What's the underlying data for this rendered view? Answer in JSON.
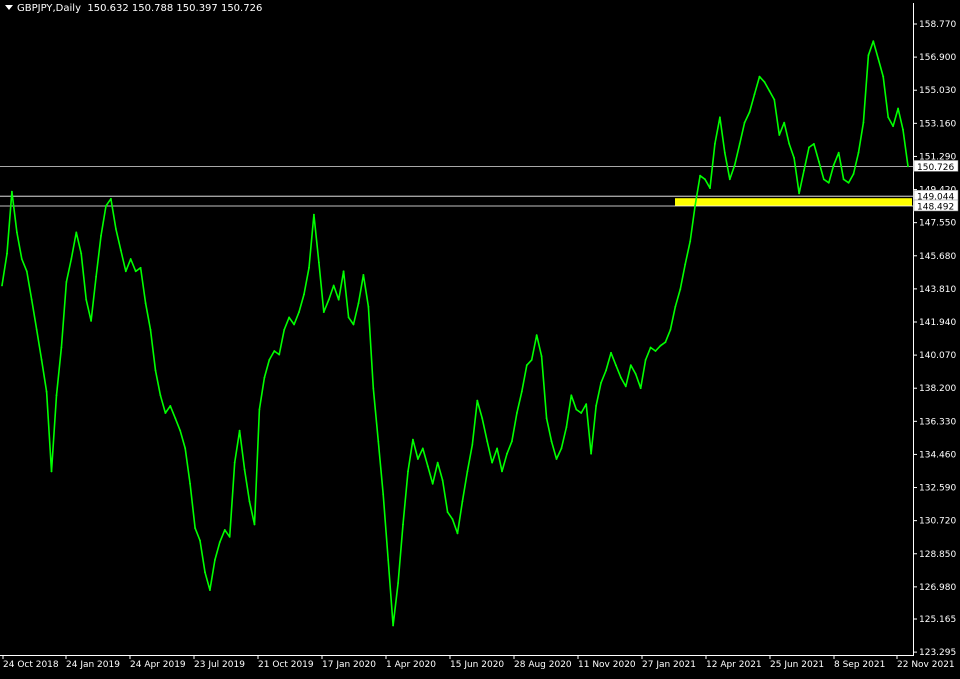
{
  "header": {
    "symbol": "GBPJPY,Daily",
    "ohlc": "150.632 150.788 150.397 150.726"
  },
  "colors": {
    "background": "#000000",
    "price_line": "#00ff00",
    "zone": "#ffff00",
    "axis": "#ffffff",
    "level_line": "#c0c0c0"
  },
  "chart_data": {
    "type": "line",
    "title": "",
    "xlabel": "",
    "ylabel": "",
    "ylim": [
      123.295,
      159.8
    ],
    "grid": false,
    "y_ticks": [
      "158.770",
      "156.900",
      "155.030",
      "153.160",
      "151.290",
      "149.420",
      "147.550",
      "145.680",
      "143.810",
      "141.940",
      "140.070",
      "138.200",
      "136.330",
      "134.460",
      "132.590",
      "130.720",
      "128.850",
      "126.980",
      "125.165",
      "123.295"
    ],
    "x_ticks": [
      "24 Oct 2018",
      "24 Jan 2019",
      "24 Apr 2019",
      "23 Jul 2019",
      "21 Oct 2019",
      "17 Jan 2020",
      "1 Apr 2020",
      "15 Jun 2020",
      "28 Aug 2020",
      "11 Nov 2020",
      "27 Jan 2021",
      "12 Apr 2021",
      "25 Jun 2021",
      "8 Sep 2021",
      "22 Nov 2021"
    ],
    "current_price": 150.726,
    "levels": [
      149.044,
      148.492
    ],
    "support_zone": [
      148.492,
      149.044
    ],
    "series": [
      {
        "values": [
          144.0,
          145.8,
          149.3,
          147.0,
          145.5,
          144.8,
          143.2,
          141.5,
          139.8,
          138.0,
          133.5,
          137.8,
          140.5,
          144.2,
          145.5,
          147.0,
          145.8,
          143.2,
          142.0,
          144.5,
          146.8,
          148.5,
          148.9,
          147.2,
          146.0,
          144.8,
          145.5,
          144.8,
          145.0,
          143.0,
          141.5,
          139.2,
          137.8,
          136.8,
          137.2,
          136.5,
          135.8,
          134.8,
          132.8,
          130.3,
          129.6,
          127.8,
          126.8,
          128.5,
          129.5,
          130.2,
          129.8,
          134.0,
          135.8,
          133.6,
          131.8,
          130.5,
          137.0,
          138.8,
          139.8,
          140.3,
          140.1,
          141.5,
          142.2,
          141.8,
          142.5,
          143.5,
          145.0,
          148.0,
          145.3,
          142.5,
          143.2,
          144.0,
          143.2,
          144.8,
          142.2,
          141.8,
          143.0,
          144.6,
          142.8,
          138.2,
          135.2,
          132.2,
          128.5,
          124.8,
          127.2,
          130.5,
          133.5,
          135.3,
          134.2,
          134.8,
          133.8,
          132.8,
          134.0,
          133.0,
          131.2,
          130.8,
          130.0,
          131.8,
          133.5,
          135.0,
          137.5,
          136.5,
          135.2,
          134.0,
          134.8,
          133.5,
          134.5,
          135.2,
          136.8,
          138.0,
          139.5,
          139.8,
          141.2,
          140.0,
          136.5,
          135.2,
          134.2,
          134.8,
          136.0,
          137.8,
          137.0,
          136.8,
          137.3,
          134.5,
          137.2,
          138.5,
          139.2,
          140.2,
          139.5,
          138.8,
          138.3,
          139.5,
          139.0,
          138.2,
          139.8,
          140.5,
          140.3,
          140.6,
          140.8,
          141.5,
          142.8,
          143.8,
          145.2,
          146.5,
          148.5,
          150.2,
          150.0,
          149.5,
          152.0,
          153.5,
          151.5,
          150.0,
          150.8,
          152.0,
          153.2,
          153.8,
          154.8,
          155.8,
          155.5,
          155.0,
          154.5,
          152.5,
          153.2,
          152.0,
          151.2,
          149.2,
          150.5,
          151.8,
          152.0,
          151.0,
          150.0,
          149.8,
          150.8,
          151.5,
          150.0,
          149.8,
          150.3,
          151.5,
          153.2,
          157.0,
          157.8,
          156.8,
          155.8,
          153.5,
          153.0,
          154.0,
          152.8,
          150.726
        ]
      }
    ]
  }
}
